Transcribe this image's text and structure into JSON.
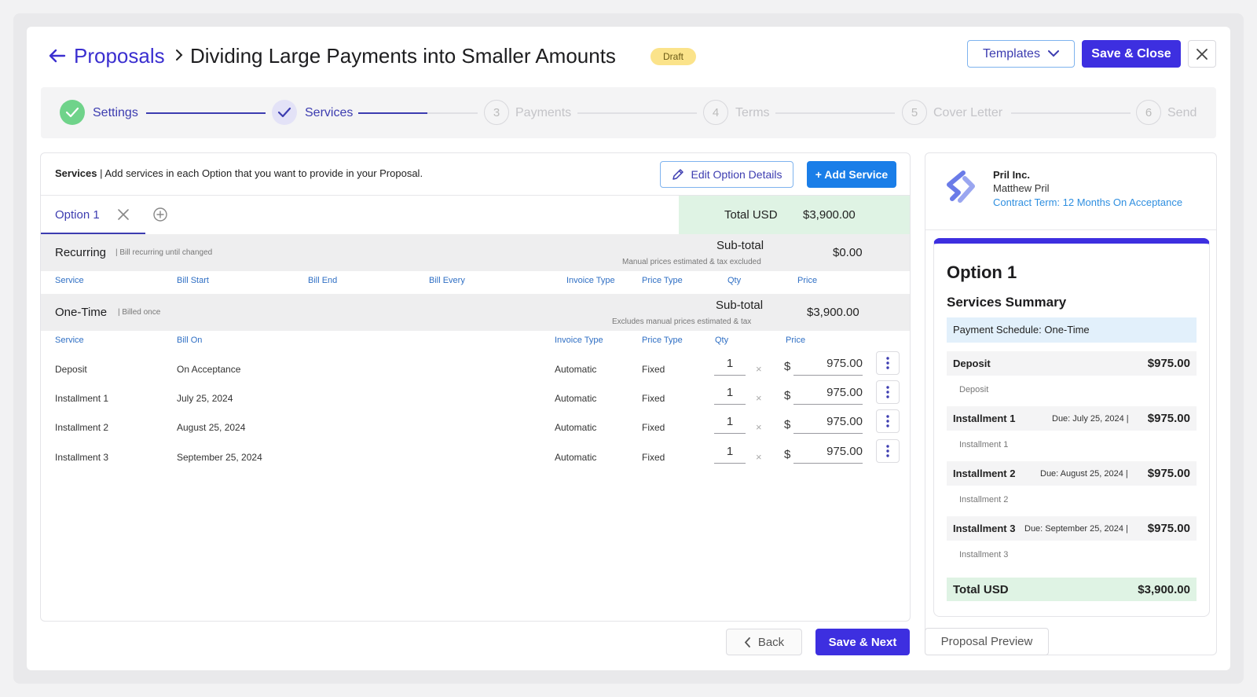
{
  "header": {
    "breadcrumb": "Proposals",
    "title": "Dividing Large Payments into Smaller Amounts",
    "status": "Draft",
    "templates_label": "Templates",
    "save_close_label": "Save & Close"
  },
  "stepper": {
    "steps": [
      {
        "label": "Settings",
        "number": "1",
        "state": "done"
      },
      {
        "label": "Services",
        "number": "2",
        "state": "current"
      },
      {
        "label": "Payments",
        "number": "3",
        "state": "todo"
      },
      {
        "label": "Terms",
        "number": "4",
        "state": "todo"
      },
      {
        "label": "Cover Letter",
        "number": "5",
        "state": "todo"
      },
      {
        "label": "Send",
        "number": "6",
        "state": "todo"
      }
    ]
  },
  "services": {
    "intro_bold": "Services",
    "intro_text": " | Add services in each Option that you want to provide in your Proposal.",
    "edit_option_label": "Edit Option Details",
    "add_service_label": "+ Add Service",
    "tab_label": "Option 1",
    "total_label": "Total USD",
    "total_value": "$3,900.00",
    "recurring": {
      "name": "Recurring",
      "note": "| Bill recurring until changed",
      "subtotal_label": "Sub-total",
      "subtotal_note": "Manual prices estimated & tax excluded",
      "subtotal_value": "$0.00",
      "columns": [
        "Service",
        "Bill Start",
        "Bill End",
        "Bill Every",
        "Invoice Type",
        "Price Type",
        "Qty",
        "Price"
      ]
    },
    "onetime": {
      "name": "One-Time",
      "note": "| Billed once",
      "subtotal_label": "Sub-total",
      "subtotal_note": "Excludes manual prices estimated & tax",
      "subtotal_value": "$3,900.00",
      "columns": [
        "Service",
        "Bill On",
        "Invoice Type",
        "Price Type",
        "Qty",
        "Price"
      ],
      "rows": [
        {
          "service": "Deposit",
          "bill_on": "On Acceptance",
          "invoice_type": "Automatic",
          "price_type": "Fixed",
          "qty": "1",
          "times": "×",
          "currency": "$",
          "price": "975.00"
        },
        {
          "service": "Installment 1",
          "bill_on": "July 25, 2024",
          "invoice_type": "Automatic",
          "price_type": "Fixed",
          "qty": "1",
          "times": "×",
          "currency": "$",
          "price": "975.00"
        },
        {
          "service": "Installment 2",
          "bill_on": "August 25, 2024",
          "invoice_type": "Automatic",
          "price_type": "Fixed",
          "qty": "1",
          "times": "×",
          "currency": "$",
          "price": "975.00"
        },
        {
          "service": "Installment 3",
          "bill_on": "September 25, 2024",
          "invoice_type": "Automatic",
          "price_type": "Fixed",
          "qty": "1",
          "times": "×",
          "currency": "$",
          "price": "975.00"
        }
      ]
    }
  },
  "footer": {
    "back_label": "Back",
    "save_next_label": "Save & Next",
    "preview_label": "Proposal Preview"
  },
  "preview": {
    "company": "Pril Inc.",
    "contact": "Matthew Pril",
    "contract_term": "Contract Term: 12 Months On Acceptance",
    "option_title": "Option 1",
    "summary_title": "Services Summary",
    "schedule": "Payment Schedule: One-Time",
    "items": [
      {
        "name": "Deposit",
        "due": "",
        "amount": "$975.00",
        "note": "Deposit"
      },
      {
        "name": "Installment 1",
        "due": "Due: July 25, 2024 |",
        "amount": "$975.00",
        "note": "Installment 1"
      },
      {
        "name": "Installment 2",
        "due": "Due: August 25, 2024 |",
        "amount": "$975.00",
        "note": "Installment 2"
      },
      {
        "name": "Installment 3",
        "due": "Due: September 25, 2024 |",
        "amount": "$975.00",
        "note": "Installment 3"
      }
    ],
    "total_label": "Total USD",
    "total_value": "$3,900.00"
  },
  "colors": {
    "primary": "#3d2fe0",
    "accent_blue": "#1a7ee8",
    "done_green": "#6fd38a",
    "draft_yellow": "#fbe38a",
    "total_green": "#dff3e4"
  },
  "icons": [
    "back-arrow-icon",
    "chevron-right-icon",
    "chevron-down-icon",
    "close-icon",
    "check-icon",
    "pencil-icon",
    "plus-circle-icon",
    "kebab-icon",
    "chevron-left-icon",
    "brand-logo-icon"
  ]
}
